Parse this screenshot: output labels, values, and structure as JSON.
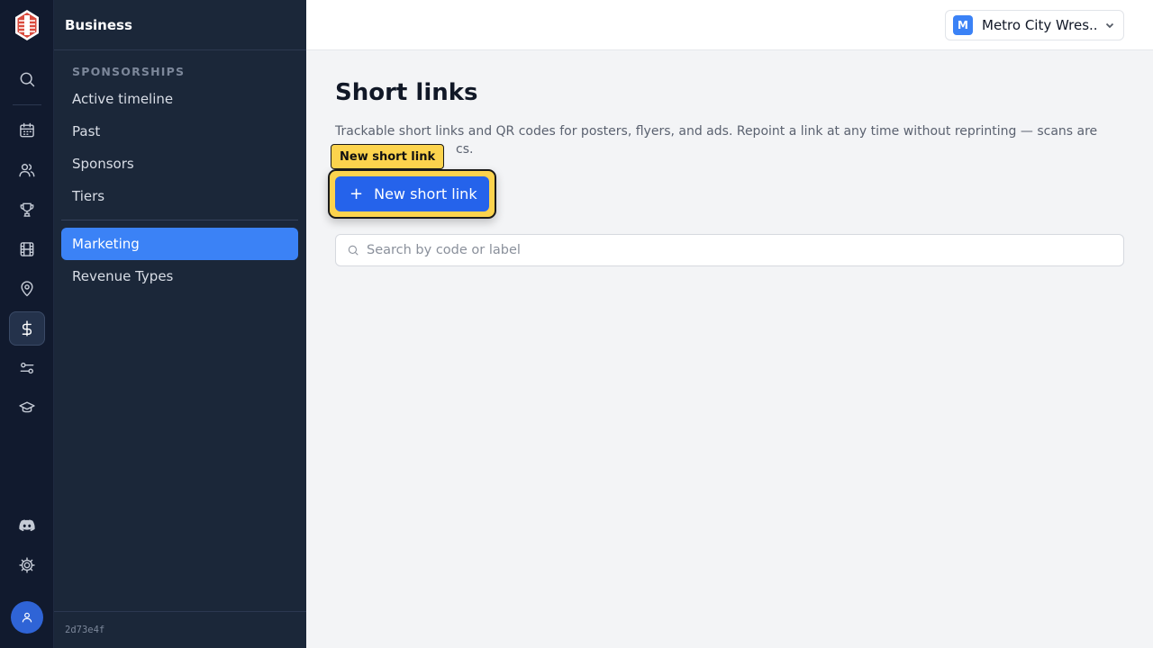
{
  "rail": {
    "icons": [
      "search-icon",
      "calendar-icon",
      "users-icon",
      "trophy-icon",
      "film-icon",
      "map-pin-icon",
      "dollar-icon",
      "sliders-icon",
      "graduation-cap-icon",
      "discord-icon",
      "settings-icon",
      "user-icon"
    ],
    "active": "dollar-icon"
  },
  "sidebar": {
    "title": "Business",
    "section_label": "SPONSORSHIPS",
    "items": [
      {
        "label": "Active timeline"
      },
      {
        "label": "Past"
      },
      {
        "label": "Sponsors"
      },
      {
        "label": "Tiers"
      },
      {
        "label": "Marketing"
      },
      {
        "label": "Revenue Types"
      }
    ],
    "active_item": "Marketing",
    "version": "2d73e4f"
  },
  "topbar": {
    "org_initial": "M",
    "org_name": "Metro City Wres..."
  },
  "main": {
    "title": "Short links",
    "description": "Trackable short links and QR codes for posters, flyers, and ads. Repoint a link at any time without reprinting — scans are",
    "description_visible_tail": "cs.",
    "tooltip": "New short link",
    "new_button_label": "New short link",
    "search_placeholder": "Search by code or label"
  },
  "colors": {
    "accent": "#3b82f6",
    "button": "#2563eb",
    "highlight": "#fcd34d",
    "rail_bg": "#111a2e",
    "sidebar_bg": "#1b2739"
  }
}
